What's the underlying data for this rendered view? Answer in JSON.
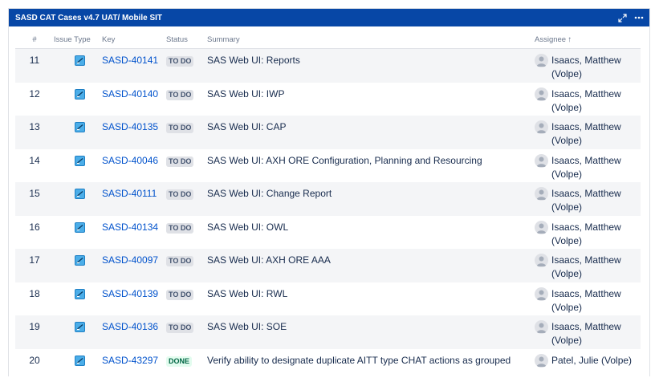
{
  "gadget": {
    "title": "SASD CAT Cases v4.7 UAT/ Mobile SIT",
    "expand_icon": "expand-icon",
    "more_icon": "more-icon"
  },
  "columns": {
    "num": "#",
    "type": "Issue Type",
    "key": "Key",
    "status": "Status",
    "summary": "Summary",
    "assignee": "Assignee",
    "assignee_sort": "↑"
  },
  "rows": [
    {
      "num": "11",
      "key": "SASD-40141",
      "status": "TO DO",
      "summary": "SAS Web UI: Reports",
      "assignee_line1": "Isaacs, Matthew",
      "assignee_line2": "(Volpe)"
    },
    {
      "num": "12",
      "key": "SASD-40140",
      "status": "TO DO",
      "summary": "SAS Web UI: IWP",
      "assignee_line1": "Isaacs, Matthew",
      "assignee_line2": "(Volpe)"
    },
    {
      "num": "13",
      "key": "SASD-40135",
      "status": "TO DO",
      "summary": "SAS Web UI: CAP",
      "assignee_line1": "Isaacs, Matthew",
      "assignee_line2": "(Volpe)"
    },
    {
      "num": "14",
      "key": "SASD-40046",
      "status": "TO DO",
      "summary": "SAS Web UI: AXH ORE Configuration, Planning and Resourcing",
      "assignee_line1": "Isaacs, Matthew",
      "assignee_line2": "(Volpe)"
    },
    {
      "num": "15",
      "key": "SASD-40111",
      "status": "TO DO",
      "summary": "SAS Web UI: Change Report",
      "assignee_line1": "Isaacs, Matthew",
      "assignee_line2": "(Volpe)"
    },
    {
      "num": "16",
      "key": "SASD-40134",
      "status": "TO DO",
      "summary": "SAS Web UI: OWL",
      "assignee_line1": "Isaacs, Matthew",
      "assignee_line2": "(Volpe)"
    },
    {
      "num": "17",
      "key": "SASD-40097",
      "status": "TO DO",
      "summary": "SAS Web UI: AXH ORE AAA",
      "assignee_line1": "Isaacs, Matthew",
      "assignee_line2": "(Volpe)"
    },
    {
      "num": "18",
      "key": "SASD-40139",
      "status": "TO DO",
      "summary": "SAS Web UI: RWL",
      "assignee_line1": "Isaacs, Matthew",
      "assignee_line2": "(Volpe)"
    },
    {
      "num": "19",
      "key": "SASD-40136",
      "status": "TO DO",
      "summary": "SAS Web UI: SOE",
      "assignee_line1": "Isaacs, Matthew",
      "assignee_line2": "(Volpe)"
    },
    {
      "num": "20",
      "key": "SASD-43297",
      "status": "DONE",
      "summary": "Verify ability to designate duplicate AITT type CHAT actions as grouped",
      "assignee_line1": "Patel, Julie (Volpe)",
      "assignee_line2": ""
    }
  ],
  "colors": {
    "header_bg": "#0747a6",
    "link": "#0052cc",
    "todo_bg": "#dfe1e6",
    "done_fg": "#006644"
  }
}
